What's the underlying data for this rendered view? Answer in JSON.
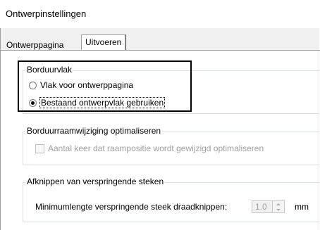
{
  "window": {
    "title": "Ontwerpinstellingen"
  },
  "tabs": [
    {
      "label": "Ontwerppagina",
      "active": false
    },
    {
      "label": "Uitvoeren",
      "active": true
    }
  ],
  "embroidery_area": {
    "legend": "Borduurvlak",
    "options": [
      {
        "label": "Vlak voor ontwerppagina",
        "selected": false
      },
      {
        "label": "Bestaand ontwerpvlak gebruiken",
        "selected": true
      }
    ]
  },
  "hoop_change": {
    "legend": "Borduurraamwijziging optimaliseren",
    "checkbox_label": "Aantal keer dat raampositie wordt gewijzigd optimaliseren",
    "checked": false,
    "enabled": false
  },
  "jump_stitch": {
    "legend": "Afknippen van verspringende steken",
    "field_label": "Minimumlengte verspringende steek draadknippen:",
    "value": "1.0",
    "unit": "mm",
    "enabled": false
  },
  "colors": {
    "dialog_bg": "#f0f0f0",
    "panel_bg": "#ffffff",
    "disabled_text": "#a0a0a0",
    "highlight_border": "#000000"
  }
}
